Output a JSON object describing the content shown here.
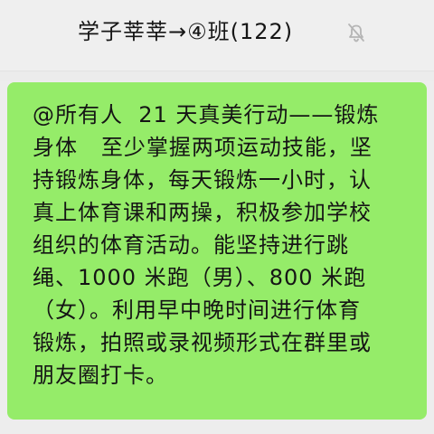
{
  "header": {
    "title": "学子莘莘→④班(122)",
    "mute_icon": "bell-off-icon"
  },
  "message": {
    "text": "@所有人  21 天真美行动——锻炼\n身体   至少掌握两项运动技能，坚\n持锻炼身体，每天锻炼一小时，认\n真上体育课和两操，积极参加学校\n组织的体育活动。能坚持进行跳\n绳、1000 米跑（男）、800 米跑\n（女）。利用早中晚时间进行体育\n锻炼，拍照或录视频形式在群里或\n朋友圈打卡。"
  },
  "colors": {
    "background": "#ececec",
    "message_bubble": "#95ec69",
    "text": "#151515",
    "icon": "#b5b5b5"
  }
}
